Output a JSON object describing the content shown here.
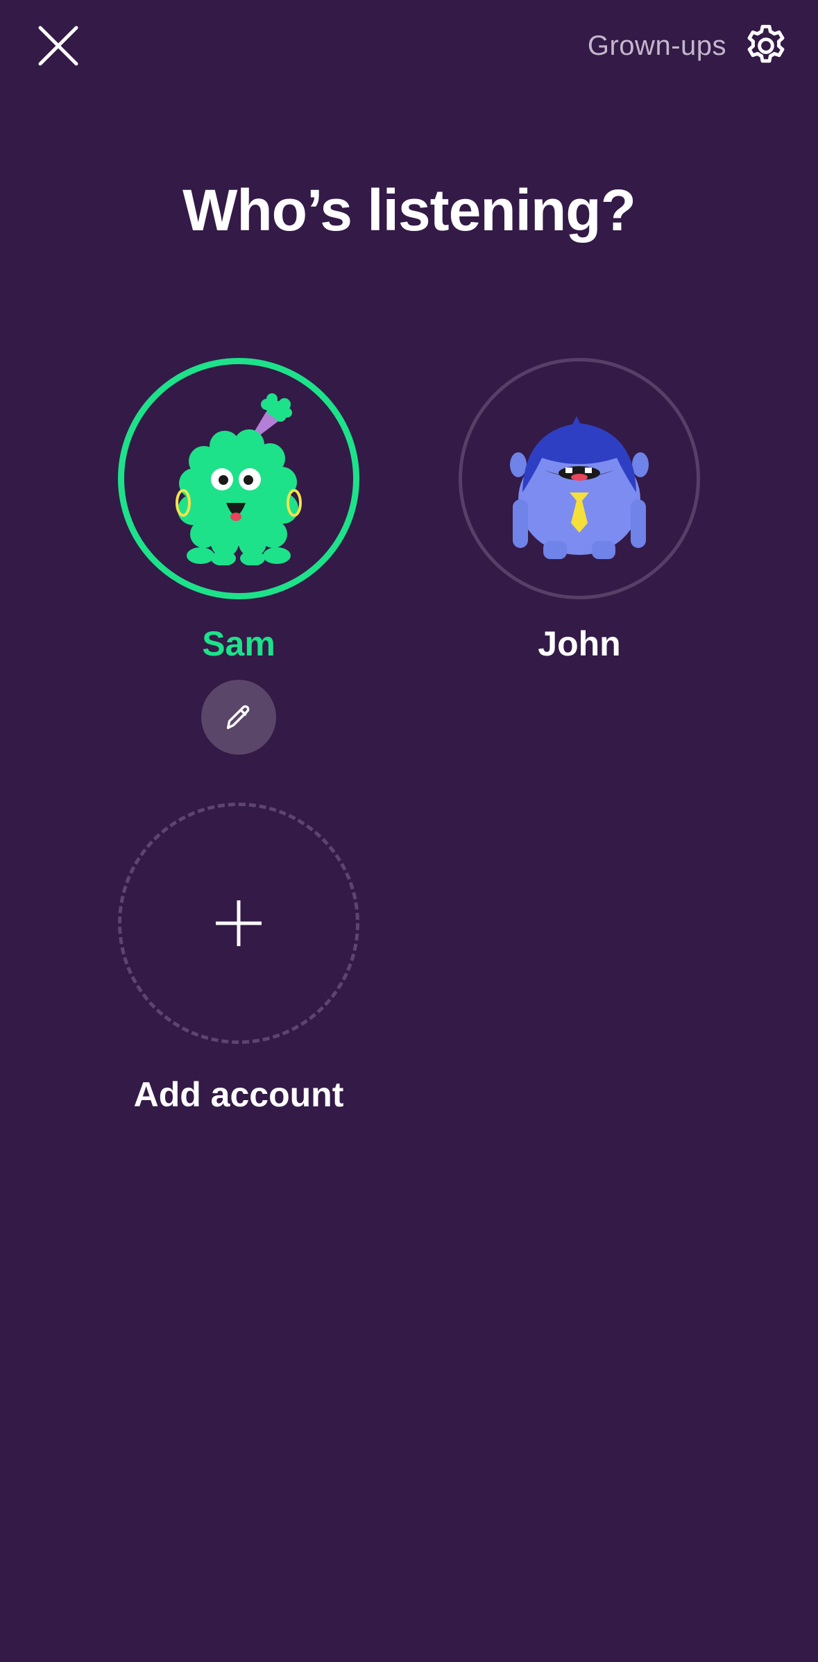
{
  "header": {
    "grownups_label": "Grown-ups",
    "close_icon": "close-icon",
    "settings_icon": "gear-icon"
  },
  "title": "Who’s listening?",
  "profiles": [
    {
      "name": "Sam",
      "selected": true,
      "avatar": "green-fluffy-monster-avatar",
      "color": "#1de28a"
    },
    {
      "name": "John",
      "selected": false,
      "avatar": "blue-monster-with-tie-avatar",
      "color": "#ffffff"
    }
  ],
  "edit_icon": "pencil-icon",
  "add_account": {
    "label": "Add account",
    "icon": "plus-icon"
  },
  "colors": {
    "background": "#341a47",
    "accent": "#1de28a"
  }
}
